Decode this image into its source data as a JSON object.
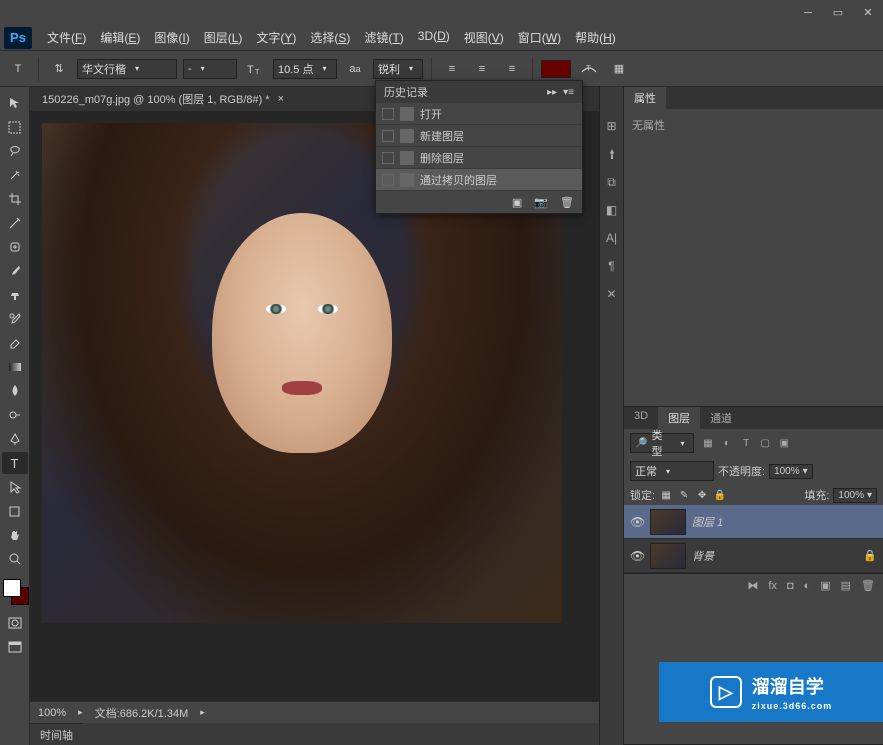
{
  "menubar": {
    "items": [
      {
        "label": "文件",
        "key": "F"
      },
      {
        "label": "编辑",
        "key": "E"
      },
      {
        "label": "图像",
        "key": "I"
      },
      {
        "label": "图层",
        "key": "L"
      },
      {
        "label": "文字",
        "key": "Y"
      },
      {
        "label": "选择",
        "key": "S"
      },
      {
        "label": "滤镜",
        "key": "T"
      },
      {
        "label": "3D",
        "key": "D"
      },
      {
        "label": "视图",
        "key": "V"
      },
      {
        "label": "窗口",
        "key": "W"
      },
      {
        "label": "帮助",
        "key": "H"
      }
    ]
  },
  "optbar": {
    "font_family": "华文行楷",
    "font_style": "-",
    "font_size": "10.5 点",
    "aa_label": "锐利",
    "text_color": "#6a0000"
  },
  "document": {
    "tab_title": "150226_m07g.jpg @ 100% (图层 1, RGB/8#) *",
    "zoom": "100%",
    "doc_label": "文档:",
    "doc_size": "686.2K/1.34M"
  },
  "timeline": {
    "label": "时间轴"
  },
  "history": {
    "title": "历史记录",
    "items": [
      {
        "label": "打开"
      },
      {
        "label": "新建图层"
      },
      {
        "label": "删除图层"
      },
      {
        "label": "通过拷贝的图层",
        "selected": true
      }
    ]
  },
  "properties": {
    "tab": "属性",
    "empty": "无属性"
  },
  "layers": {
    "tabs": [
      "3D",
      "图层",
      "通道"
    ],
    "active_tab": "图层",
    "filter_label": "类型",
    "blend_mode": "正常",
    "opacity_label": "不透明度:",
    "opacity_value": "100%",
    "lock_label": "锁定:",
    "fill_label": "填充:",
    "fill_value": "100%",
    "items": [
      {
        "name": "图层 1",
        "selected": true
      },
      {
        "name": "背景",
        "locked": true
      }
    ]
  },
  "watermark": {
    "title": "溜溜自学",
    "url": "zixue.3d66.com"
  }
}
